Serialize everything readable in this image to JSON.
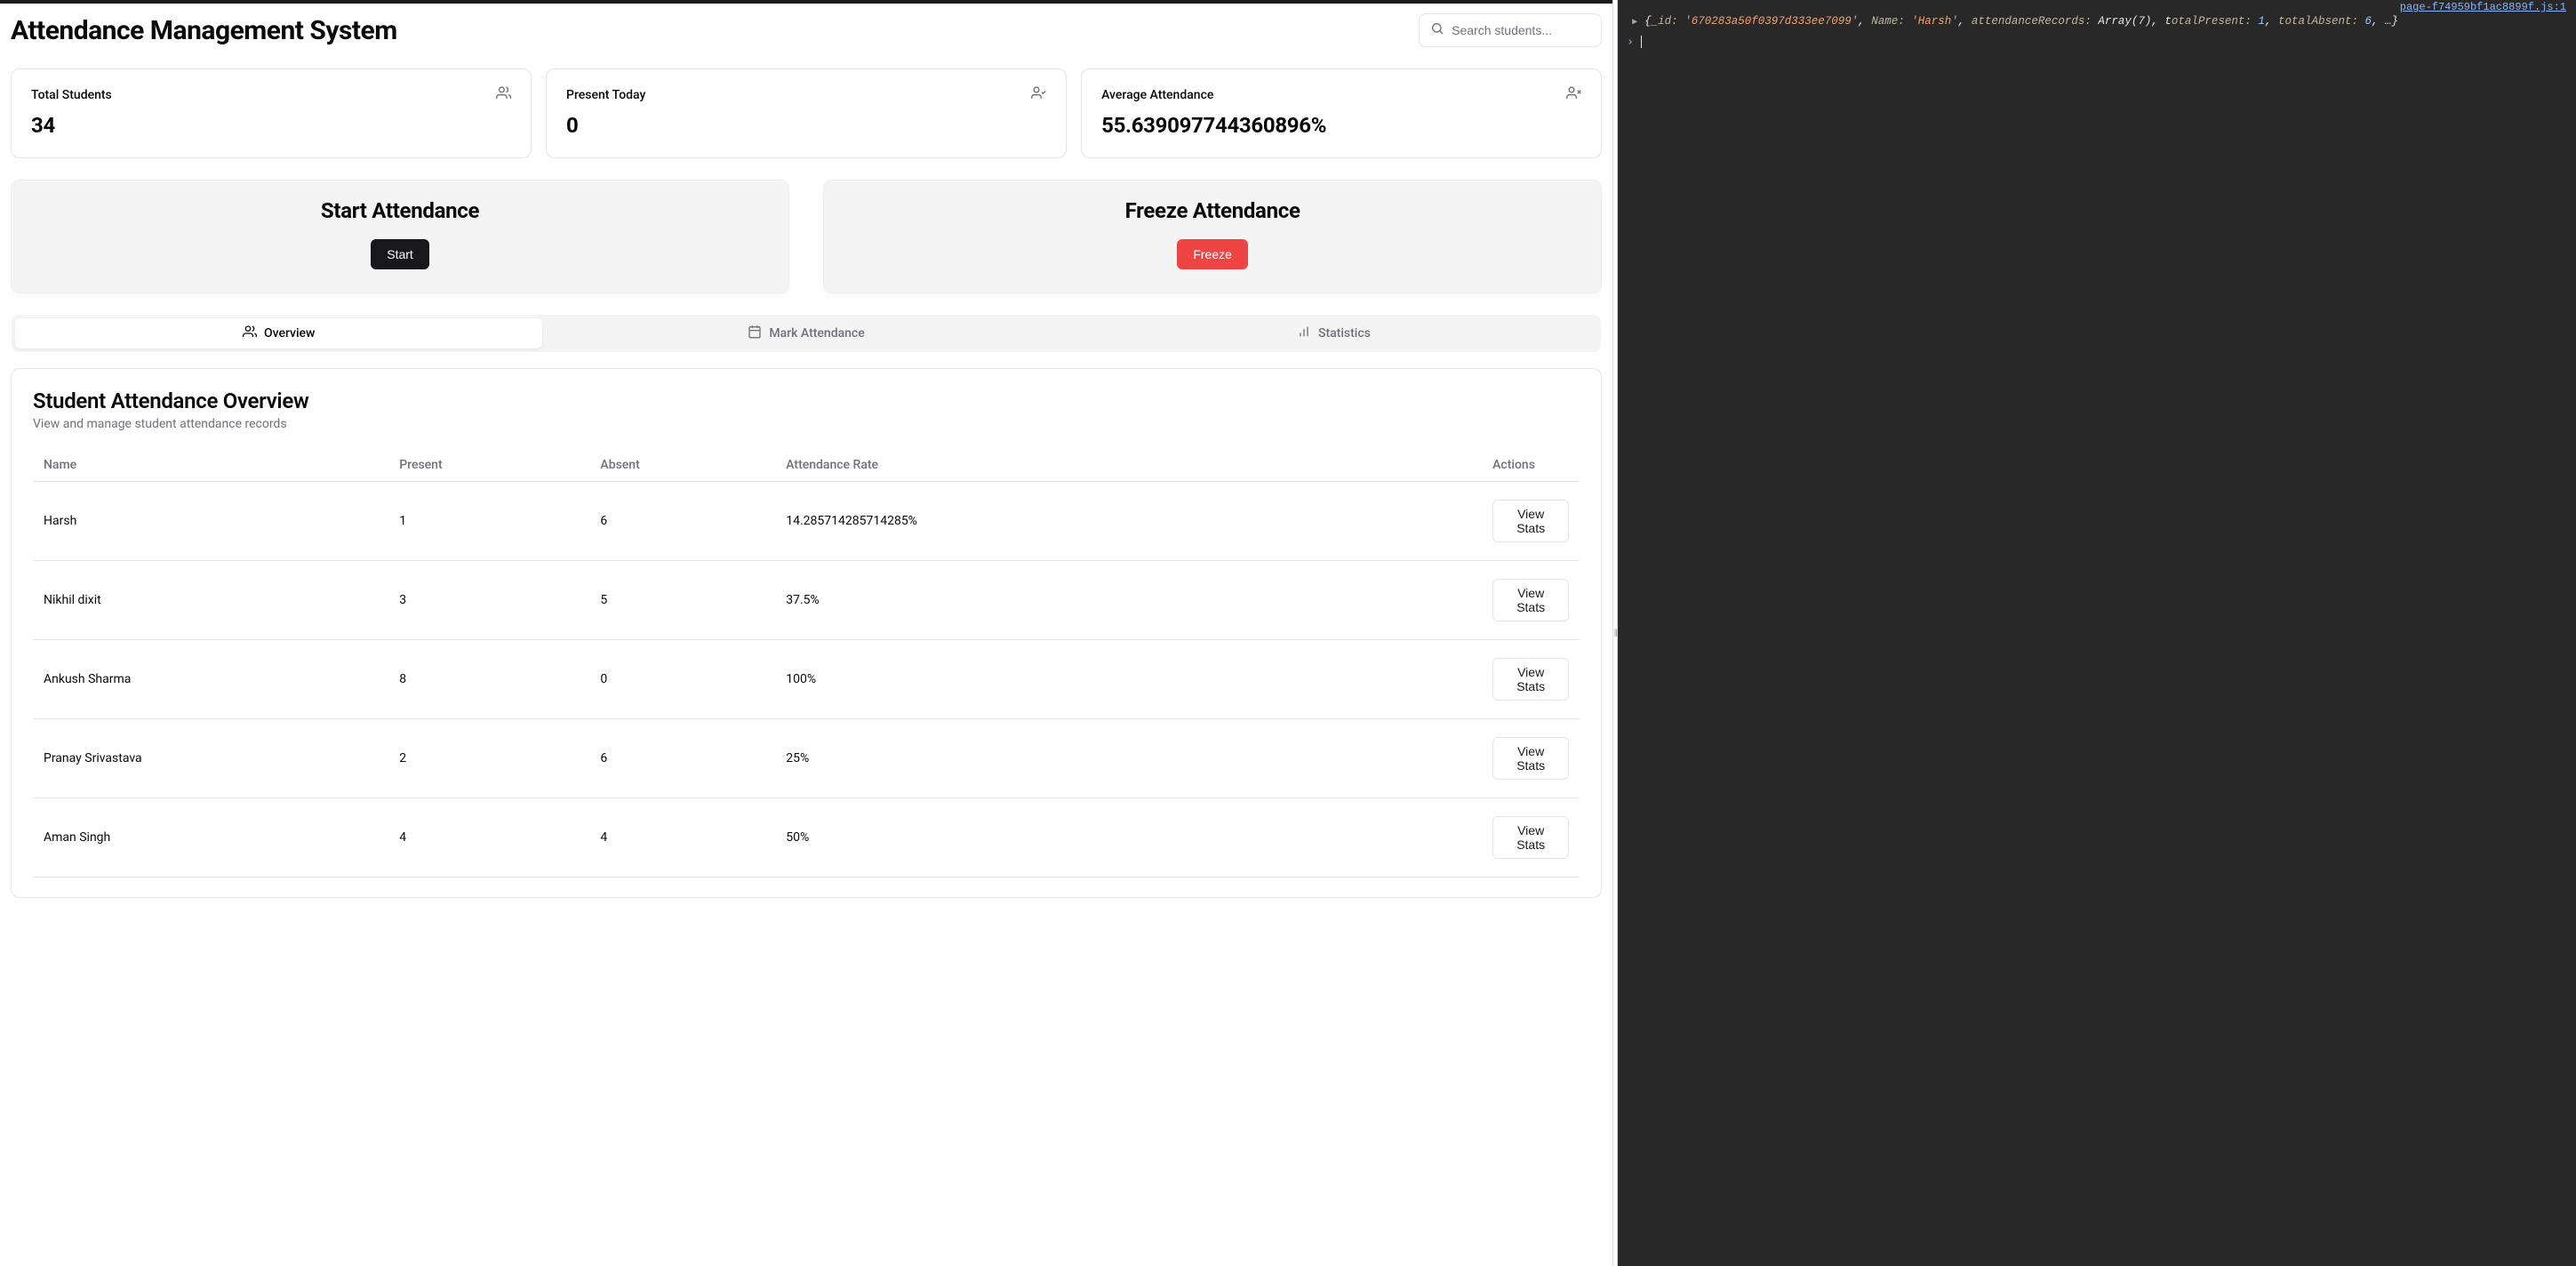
{
  "header": {
    "title": "Attendance Management System",
    "search_placeholder": "Search students..."
  },
  "stats": [
    {
      "label": "Total Students",
      "value": "34",
      "icon": "users"
    },
    {
      "label": "Present Today",
      "value": "0",
      "icon": "user-check"
    },
    {
      "label": "Average Attendance",
      "value": "55.639097744360896%",
      "icon": "user-x"
    }
  ],
  "actions": {
    "start": {
      "title": "Start Attendance",
      "button": "Start"
    },
    "freeze": {
      "title": "Freeze Attendance",
      "button": "Freeze"
    }
  },
  "tabs": [
    {
      "id": "overview",
      "label": "Overview",
      "icon": "users",
      "active": true
    },
    {
      "id": "mark",
      "label": "Mark Attendance",
      "icon": "calendar",
      "active": false
    },
    {
      "id": "stats",
      "label": "Statistics",
      "icon": "bars",
      "active": false
    }
  ],
  "table": {
    "title": "Student Attendance Overview",
    "subtitle": "View and manage student attendance records",
    "columns": [
      "Name",
      "Present",
      "Absent",
      "Attendance Rate",
      "Actions"
    ],
    "action_label": "View Stats",
    "rows": [
      {
        "name": "Harsh",
        "present": "1",
        "absent": "6",
        "rate": "14.285714285714285%"
      },
      {
        "name": "Nikhil dixit",
        "present": "3",
        "absent": "5",
        "rate": "37.5%"
      },
      {
        "name": "Ankush Sharma",
        "present": "8",
        "absent": "0",
        "rate": "100%"
      },
      {
        "name": "Pranay Srivastava",
        "present": "2",
        "absent": "6",
        "rate": "25%"
      },
      {
        "name": "Aman Singh",
        "present": "4",
        "absent": "4",
        "rate": "50%"
      }
    ]
  },
  "console": {
    "source": "page-f74959bf1ac8899f.js:1",
    "log_parts": {
      "brace_open": "{",
      "id_key": "_id:",
      "id_val": "'670283a50f0397d333ee7099'",
      "name_key": "Name:",
      "name_val": "'Harsh'",
      "records_key": "attendanceRecords:",
      "records_val": "Array(7)",
      "present_label": "totalPresent:",
      "present_val": "1",
      "absent_label": "totalAbsent:",
      "absent_val": "6",
      "tail": ", …}"
    }
  }
}
